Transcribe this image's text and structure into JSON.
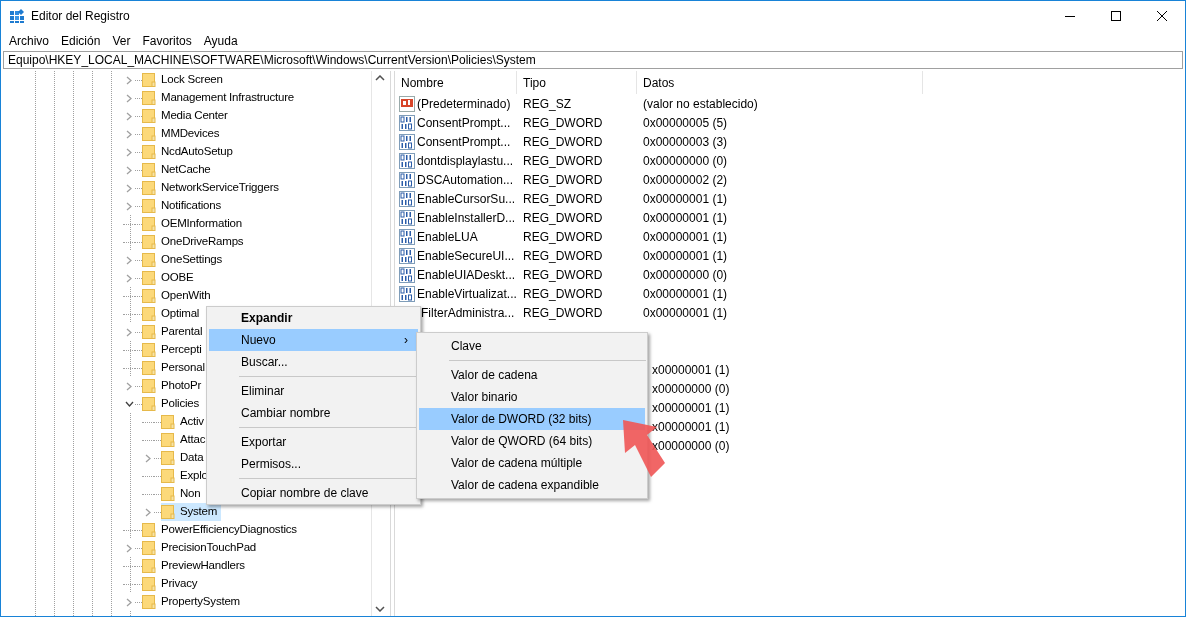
{
  "window": {
    "title": "Editor del Registro"
  },
  "menu_bar": [
    "Archivo",
    "Edición",
    "Ver",
    "Favoritos",
    "Ayuda"
  ],
  "address": "Equipo\\HKEY_LOCAL_MACHINE\\SOFTWARE\\Microsoft\\Windows\\CurrentVersion\\Policies\\System",
  "tree": [
    {
      "label": "Lock Screen",
      "expanded": false,
      "selected": false
    },
    {
      "label": "Management Infrastructure",
      "expanded": false,
      "selected": false
    },
    {
      "label": "Media Center",
      "expanded": false,
      "selected": false
    },
    {
      "label": "MMDevices",
      "expanded": false,
      "selected": false
    },
    {
      "label": "NcdAutoSetup",
      "expanded": false,
      "selected": false
    },
    {
      "label": "NetCache",
      "expanded": false,
      "selected": false
    },
    {
      "label": "NetworkServiceTriggers",
      "expanded": false,
      "selected": false
    },
    {
      "label": "Notifications",
      "expanded": false,
      "selected": false
    },
    {
      "label": "OEMInformation",
      "selected": false
    },
    {
      "label": "OneDriveRamps",
      "selected": false
    },
    {
      "label": "OneSettings",
      "expanded": false,
      "selected": false
    },
    {
      "label": "OOBE",
      "expanded": false,
      "selected": false
    },
    {
      "label": "OpenWith",
      "selected": false
    },
    {
      "label": "Optimal",
      "selected": false
    },
    {
      "label": "Parental",
      "expanded": false,
      "selected": false
    },
    {
      "label": "Percepti",
      "selected": false
    },
    {
      "label": "Personal",
      "selected": false
    },
    {
      "label": "PhotoPr",
      "expanded": false,
      "selected": false
    },
    {
      "label": "Policies",
      "expanded": true,
      "selected": false,
      "children": [
        {
          "label": "Activ",
          "selected": false
        },
        {
          "label": "Attac",
          "selected": false
        },
        {
          "label": "Data",
          "expanded": false,
          "selected": false
        },
        {
          "label": "Explo",
          "selected": false
        },
        {
          "label": "Non",
          "selected": false
        },
        {
          "label": "System",
          "expanded": false,
          "selected": true
        }
      ]
    },
    {
      "label": "PowerEfficiencyDiagnostics",
      "selected": false
    },
    {
      "label": "PrecisionTouchPad",
      "expanded": false,
      "selected": false
    },
    {
      "label": "PreviewHandlers",
      "selected": false
    },
    {
      "label": "Privacy",
      "selected": false
    },
    {
      "label": "PropertySystem",
      "expanded": false,
      "selected": false
    }
  ],
  "table": {
    "columns": [
      "Nombre",
      "Tipo",
      "Datos"
    ],
    "rows": [
      {
        "kind": "string",
        "name": "(Predeterminado)",
        "type": "REG_SZ",
        "data": "(valor no establecido)"
      },
      {
        "kind": "binary",
        "name": "ConsentPrompt...",
        "type": "REG_DWORD",
        "data": "0x00000005 (5)"
      },
      {
        "kind": "binary",
        "name": "ConsentPrompt...",
        "type": "REG_DWORD",
        "data": "0x00000003 (3)"
      },
      {
        "kind": "binary",
        "name": "dontdisplaylastu...",
        "type": "REG_DWORD",
        "data": "0x00000000 (0)"
      },
      {
        "kind": "binary",
        "name": "DSCAutomation...",
        "type": "REG_DWORD",
        "data": "0x00000002 (2)"
      },
      {
        "kind": "binary",
        "name": "EnableCursorSu...",
        "type": "REG_DWORD",
        "data": "0x00000001 (1)"
      },
      {
        "kind": "binary",
        "name": "EnableInstallerD...",
        "type": "REG_DWORD",
        "data": "0x00000001 (1)"
      },
      {
        "kind": "binary",
        "name": "EnableLUA",
        "type": "REG_DWORD",
        "data": "0x00000001 (1)"
      },
      {
        "kind": "binary",
        "name": "EnableSecureUI...",
        "type": "REG_DWORD",
        "data": "0x00000001 (1)"
      },
      {
        "kind": "binary",
        "name": "EnableUIADeskt...",
        "type": "REG_DWORD",
        "data": "0x00000000 (0)"
      },
      {
        "kind": "binary",
        "name": "EnableVirtualizat...",
        "type": "REG_DWORD",
        "data": "0x00000001 (1)"
      },
      {
        "kind": "covered",
        "name": "FilterAdministra...",
        "type": "REG_DWORD",
        "data": "0x00000001 (1)"
      },
      {
        "kind": "data_only",
        "data": "x00000001 (1)"
      },
      {
        "kind": "data_only",
        "data": "x00000000 (0)"
      },
      {
        "kind": "data_only",
        "data": "x00000001 (1)"
      },
      {
        "kind": "data_only",
        "data": "x00000001 (1)"
      },
      {
        "kind": "data_only",
        "data": "x00000000 (0)"
      }
    ]
  },
  "context_menu": [
    {
      "kind": "item",
      "label": "Expandir",
      "bold": true,
      "selected": false
    },
    {
      "kind": "submenu",
      "label": "Nuevo",
      "bold": false,
      "selected": true,
      "arrow": "›"
    },
    {
      "kind": "item",
      "label": "Buscar...",
      "bold": false,
      "selected": false
    },
    {
      "kind": "separator"
    },
    {
      "kind": "item",
      "label": "Eliminar",
      "bold": false,
      "selected": false
    },
    {
      "kind": "item",
      "label": "Cambiar nombre",
      "bold": false,
      "selected": false
    },
    {
      "kind": "separator"
    },
    {
      "kind": "item",
      "label": "Exportar",
      "bold": false,
      "selected": false
    },
    {
      "kind": "item",
      "label": "Permisos...",
      "bold": false,
      "selected": false
    },
    {
      "kind": "separator"
    },
    {
      "kind": "item",
      "label": "Copiar nombre de clave",
      "bold": false,
      "selected": false
    }
  ],
  "submenu": [
    {
      "kind": "item",
      "label": "Clave",
      "selected": false
    },
    {
      "kind": "separator"
    },
    {
      "kind": "item",
      "label": "Valor de cadena",
      "selected": false
    },
    {
      "kind": "item",
      "label": "Valor binario",
      "selected": false
    },
    {
      "kind": "item",
      "label": "Valor de DWORD (32 bits)",
      "selected": true
    },
    {
      "kind": "item",
      "label": "Valor de QWORD (64 bits)",
      "selected": false
    },
    {
      "kind": "item",
      "label": "Valor de cadena múltiple",
      "selected": false
    },
    {
      "kind": "item",
      "label": "Valor de cadena expandible",
      "selected": false
    }
  ]
}
